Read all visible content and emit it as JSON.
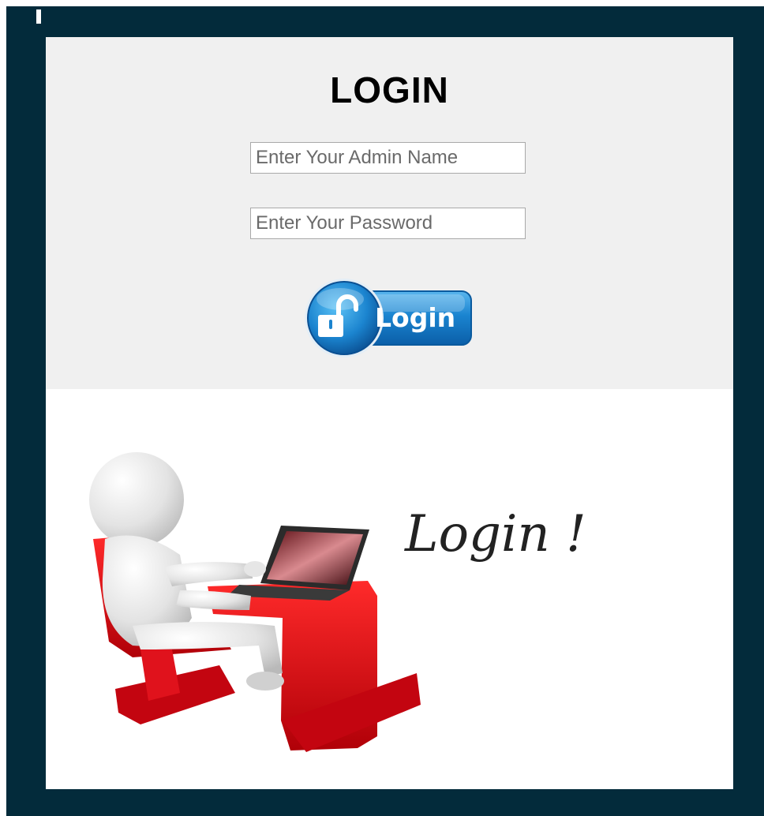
{
  "form": {
    "title": "LOGIN",
    "admin_name_placeholder": "Enter Your Admin Name",
    "password_placeholder": "Enter Your Password",
    "login_button_label": "Login"
  },
  "illustration": {
    "caption": "Login !"
  },
  "colors": {
    "frame": "#032b3b",
    "form_panel": "#f0f0f0",
    "button_blue": "#1a7fc9",
    "accent_red": "#d40f1a"
  }
}
